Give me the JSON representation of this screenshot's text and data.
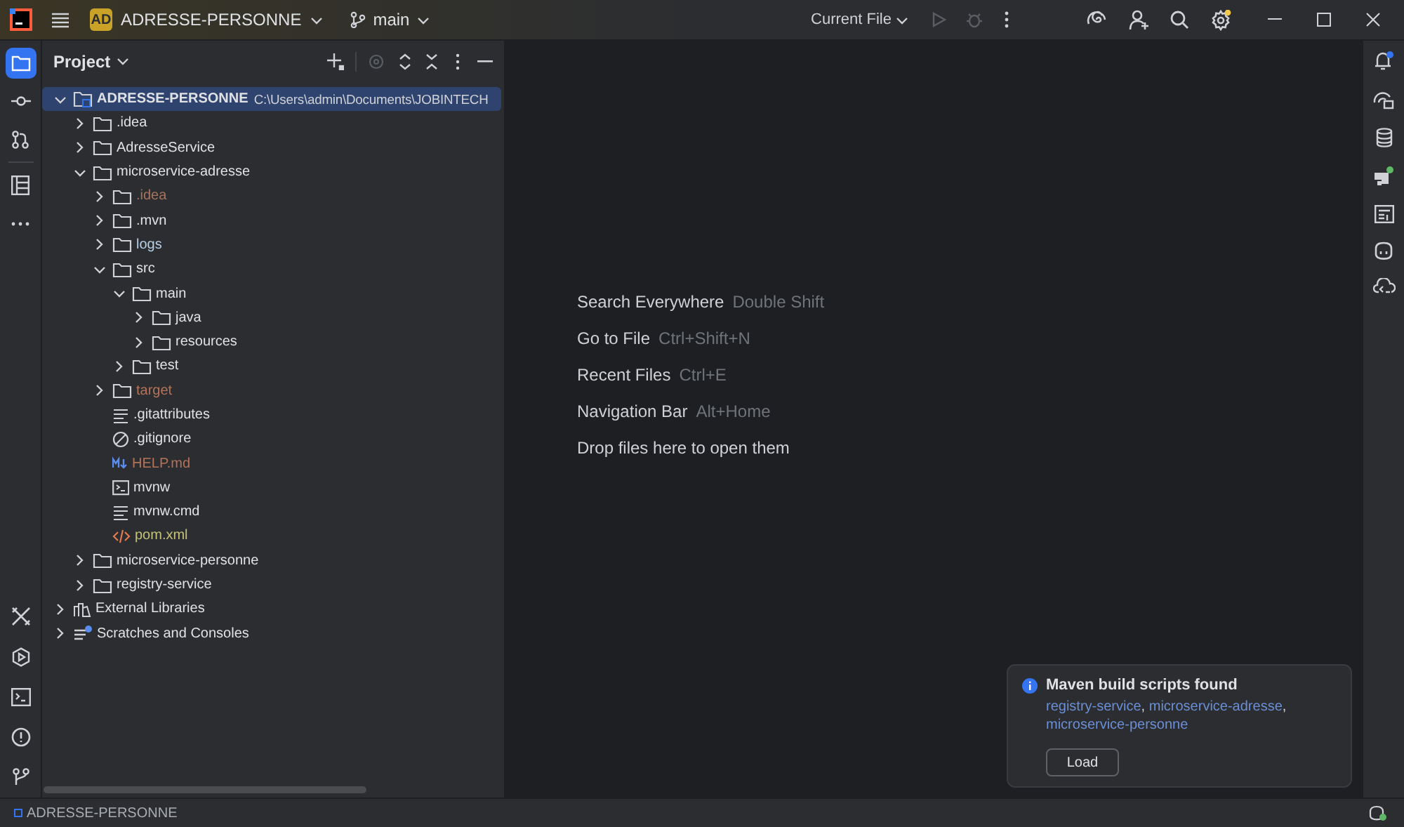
{
  "title_bar": {
    "project_badge": "AD",
    "project_name": "ADRESSE-PERSONNE",
    "branch": "main",
    "run_config": "Current File"
  },
  "tool_window": {
    "title": "Project"
  },
  "tree": [
    {
      "label": "ADRESSE-PERSONNE",
      "path": "C:\\Users\\admin\\Documents\\JOBINTECH",
      "kind": "module-root",
      "expanded": true,
      "selected": true,
      "color": "#dfe1e5",
      "children": [
        {
          "label": ".idea",
          "kind": "folder",
          "expanded": false,
          "selected": false,
          "color": "#dfe1e5"
        },
        {
          "label": "AdresseService",
          "kind": "folder",
          "expanded": false,
          "selected": false,
          "color": "#dfe1e5"
        },
        {
          "label": "microservice-adresse",
          "kind": "folder",
          "expanded": true,
          "selected": false,
          "color": "#dfe1e5",
          "children": [
            {
              "label": ".idea",
              "kind": "folder",
              "expanded": false,
              "selected": false,
              "color": "#a8745c"
            },
            {
              "label": ".mvn",
              "kind": "folder",
              "expanded": false,
              "selected": false,
              "color": "#dfe1e5"
            },
            {
              "label": "logs",
              "kind": "folder",
              "expanded": false,
              "selected": false,
              "color": "#b9cfe6"
            },
            {
              "label": "src",
              "kind": "folder",
              "expanded": true,
              "selected": false,
              "color": "#dfe1e5",
              "children": [
                {
                  "label": "main",
                  "kind": "folder",
                  "expanded": true,
                  "selected": false,
                  "color": "#dfe1e5",
                  "children": [
                    {
                      "label": "java",
                      "kind": "folder",
                      "expanded": false,
                      "selected": false,
                      "color": "#dfe1e5"
                    },
                    {
                      "label": "resources",
                      "kind": "folder",
                      "expanded": false,
                      "selected": false,
                      "color": "#dfe1e5"
                    }
                  ]
                },
                {
                  "label": "test",
                  "kind": "folder",
                  "expanded": false,
                  "selected": false,
                  "color": "#dfe1e5"
                }
              ]
            },
            {
              "label": "target",
              "kind": "folder",
              "expanded": false,
              "selected": false,
              "color": "#b5735a"
            },
            {
              "label": ".gitattributes",
              "kind": "text-file",
              "selected": false,
              "color": "#dfe1e5"
            },
            {
              "label": ".gitignore",
              "kind": "ignore-file",
              "selected": false,
              "color": "#dfe1e5"
            },
            {
              "label": "HELP.md",
              "kind": "markdown-file",
              "selected": false,
              "color": "#b5735a"
            },
            {
              "label": "mvnw",
              "kind": "script-file",
              "selected": false,
              "color": "#dfe1e5"
            },
            {
              "label": "mvnw.cmd",
              "kind": "text-file",
              "selected": false,
              "color": "#dfe1e5"
            },
            {
              "label": "pom.xml",
              "kind": "xml-file",
              "selected": false,
              "color": "#c4c27a"
            }
          ]
        },
        {
          "label": "microservice-personne",
          "kind": "folder",
          "expanded": false,
          "selected": false,
          "color": "#dfe1e5"
        },
        {
          "label": "registry-service",
          "kind": "folder",
          "expanded": false,
          "selected": false,
          "color": "#dfe1e5"
        }
      ]
    },
    {
      "label": "External Libraries",
      "kind": "libraries",
      "expanded": false,
      "selected": false,
      "color": "#dfe1e5"
    },
    {
      "label": "Scratches and Consoles",
      "kind": "scratches",
      "expanded": false,
      "selected": false,
      "color": "#dfe1e5"
    }
  ],
  "editor_hints": [
    {
      "action": "Search Everywhere",
      "shortcut": "Double Shift"
    },
    {
      "action": "Go to File",
      "shortcut": "Ctrl+Shift+N"
    },
    {
      "action": "Recent Files",
      "shortcut": "Ctrl+E"
    },
    {
      "action": "Navigation Bar",
      "shortcut": "Alt+Home"
    },
    {
      "action": "Drop files here to open them"
    }
  ],
  "notification": {
    "title": "Maven build scripts found",
    "links": [
      "registry-service",
      "microservice-adresse",
      "microservice-personne"
    ],
    "separator": ",",
    "button": "Load"
  },
  "status_bar": {
    "project": "ADRESSE-PERSONNE"
  }
}
